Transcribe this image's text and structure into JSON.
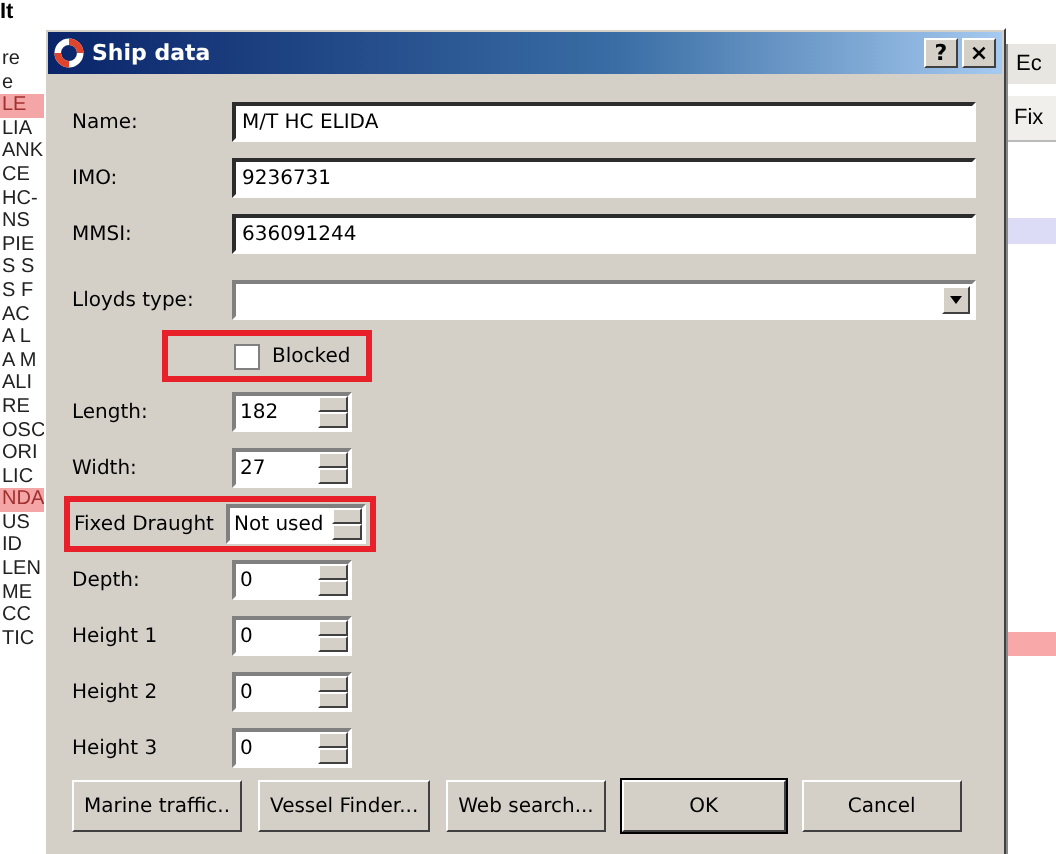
{
  "caption": "It",
  "background": {
    "left_rows": [
      {
        "text": "re",
        "highlighted": false
      },
      {
        "text": "e",
        "highlighted": false
      },
      {
        "text": "LE",
        "highlighted": true
      },
      {
        "text": "LIA",
        "highlighted": false
      },
      {
        "text": "ANK",
        "highlighted": false
      },
      {
        "text": "CE",
        "highlighted": false
      },
      {
        "text": "HC-",
        "highlighted": false
      },
      {
        "text": "NS",
        "highlighted": false
      },
      {
        "text": "PIE",
        "highlighted": false
      },
      {
        "text": "S S",
        "highlighted": false
      },
      {
        "text": "S F",
        "highlighted": false
      },
      {
        "text": "AC",
        "highlighted": false
      },
      {
        "text": "A L",
        "highlighted": false
      },
      {
        "text": "A M",
        "highlighted": false
      },
      {
        "text": "ALI",
        "highlighted": false
      },
      {
        "text": "RE",
        "highlighted": false
      },
      {
        "text": "OSC",
        "highlighted": false
      },
      {
        "text": "ORI",
        "highlighted": false
      },
      {
        "text": "LIC",
        "highlighted": false
      },
      {
        "text": "NDA",
        "highlighted": true
      },
      {
        "text": "US",
        "highlighted": false
      },
      {
        "text": "ID",
        "highlighted": false
      },
      {
        "text": "LEN",
        "highlighted": false
      },
      {
        "text": "ME",
        "highlighted": false
      },
      {
        "text": "CC",
        "highlighted": false
      },
      {
        "text": "TIC",
        "highlighted": false
      }
    ],
    "right_top": "Ec",
    "right_header": "Fix"
  },
  "window": {
    "title": "Ship data",
    "help": "?",
    "close": "×"
  },
  "fields": [
    {
      "kind": "text",
      "label": "Name:",
      "value": "M/T HC ELIDA",
      "highlighted": false
    },
    {
      "kind": "text",
      "label": "IMO:",
      "value": "9236731",
      "highlighted": false
    },
    {
      "kind": "text",
      "label": "MMSI:",
      "value": "636091244",
      "highlighted": false
    },
    {
      "kind": "dropdown",
      "label": "Lloyds type:",
      "highlighted": false
    },
    {
      "kind": "checkbox",
      "label": "Blocked",
      "checked": false,
      "highlighted": true
    },
    {
      "kind": "spinner",
      "label": "Length:",
      "value": "182",
      "highlighted": false
    },
    {
      "kind": "spinner",
      "label": "Width:",
      "value": "27",
      "highlighted": false
    },
    {
      "kind": "spinner",
      "label": "Fixed Draught",
      "value": "Not used",
      "highlighted": true
    },
    {
      "kind": "spinner",
      "label": "Depth:",
      "value": "0",
      "highlighted": false
    },
    {
      "kind": "spinner",
      "label": "Height 1",
      "value": "0",
      "highlighted": false
    },
    {
      "kind": "spinner",
      "label": "Height 2",
      "value": "0",
      "highlighted": false
    },
    {
      "kind": "spinner",
      "label": "Height 3",
      "value": "0",
      "highlighted": false
    }
  ],
  "buttons": [
    {
      "label": "Marine traffic..",
      "default": false
    },
    {
      "label": "Vessel Finder...",
      "default": false
    },
    {
      "label": "Web search...",
      "default": false
    },
    {
      "label": "OK",
      "default": true
    },
    {
      "label": "Cancel",
      "default": false
    }
  ]
}
